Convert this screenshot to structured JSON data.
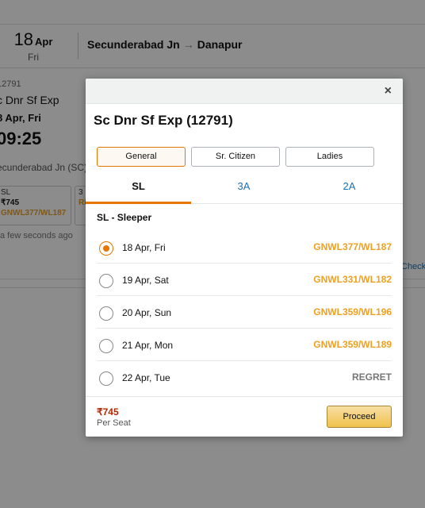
{
  "background": {
    "header": {
      "day": "18",
      "month": "Apr",
      "weekday": "Fri",
      "from": "Secunderabad Jn",
      "arrow": "→",
      "to": "Danapur"
    },
    "card": {
      "train_number": "12791",
      "train_name": "c Dnr Sf Exp",
      "date": "8 Apr, Fri",
      "time": "09:25",
      "station": "ecunderabad Jn (SC)",
      "classes": [
        {
          "name": "SL",
          "price": "₹745",
          "status": "GNWL377/WL187"
        },
        {
          "name": "3",
          "price": "",
          "status": "RE"
        }
      ],
      "updated": "a few seconds ago",
      "check": "Check"
    }
  },
  "modal": {
    "close": "×",
    "title": "Sc Dnr Sf Exp (12791)",
    "quotas": [
      "General",
      "Sr. Citizen",
      "Ladies"
    ],
    "selected_quota": "General",
    "tabs": [
      "SL",
      "3A",
      "2A"
    ],
    "selected_tab": "SL",
    "class_label": "SL - Sleeper",
    "dates": [
      {
        "date": "18 Apr, Fri",
        "status": "GNWL377/WL187",
        "selected": true
      },
      {
        "date": "19 Apr, Sat",
        "status": "GNWL331/WL182",
        "selected": false
      },
      {
        "date": "20 Apr, Sun",
        "status": "GNWL359/WL196",
        "selected": false
      },
      {
        "date": "21 Apr, Mon",
        "status": "GNWL359/WL189",
        "selected": false
      },
      {
        "date": "22 Apr, Tue",
        "status": "REGRET",
        "selected": false
      }
    ],
    "price": "₹745",
    "per_seat": "Per Seat",
    "proceed": "Proceed"
  },
  "colors": {
    "accent": "#e77600",
    "waitlist": "#f0a020",
    "price": "#b12704",
    "link": "#1a6fb5"
  }
}
